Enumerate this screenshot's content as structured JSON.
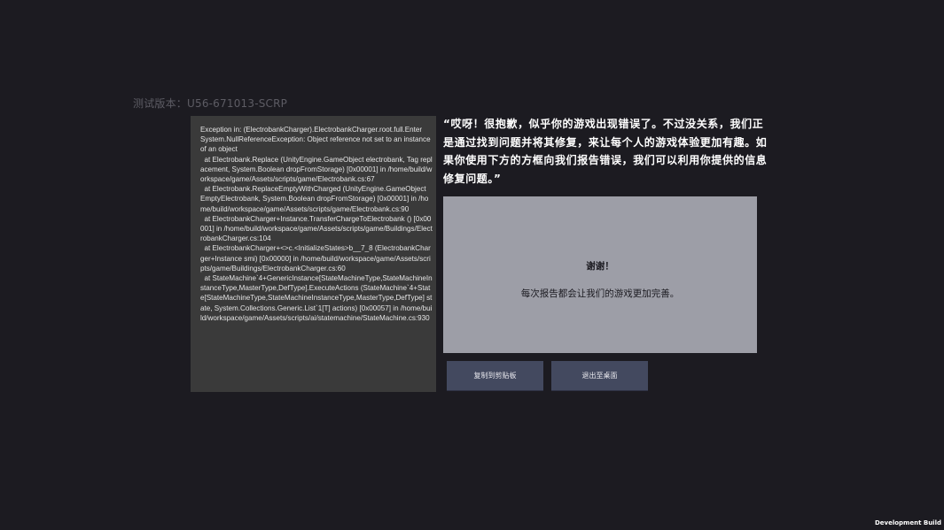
{
  "version_label": "测试版本：U56-671013-SCRP",
  "log": {
    "text": "Exception in: (ElectrobankCharger).ElectrobankCharger.root.full.Enter\nSystem.NullReferenceException: Object reference not set to an instance of an object\n  at Electrobank.Replace (UnityEngine.GameObject electrobank, Tag replacement, System.Boolean dropFromStorage) [0x00001] in /home/build/workspace/game/Assets/scripts/game/Electrobank.cs:67\n  at Electrobank.ReplaceEmptyWithCharged (UnityEngine.GameObject EmptyElectrobank, System.Boolean dropFromStorage) [0x00001] in /home/build/workspace/game/Assets/scripts/game/Electrobank.cs:90\n  at ElectrobankCharger+Instance.TransferChargeToElectrobank () [0x00001] in /home/build/workspace/game/Assets/scripts/game/Buildings/ElectrobankCharger.cs:104\n  at ElectrobankCharger+<>c.<InitializeStates>b__7_8 (ElectrobankCharger+Instance smi) [0x00000] in /home/build/workspace/game/Assets/scripts/game/Buildings/ElectrobankCharger.cs:60\n  at StateMachine`4+GenericInstance[StateMachineType,StateMachineInstanceType,MasterType,DefType].ExecuteActions (StateMachine`4+State[StateMachineType,StateMachineInstanceType,MasterType,DefType] state, System.Collections.Generic.List`1[T] actions) [0x00057] in /home/build/workspace/game/Assets/scripts/ai/statemachine/StateMachine.cs:930"
  },
  "apology_text": "“哎呀！很抱歉，似乎你的游戏出现错误了。不过没关系，我们正是通过找到问题并将其修复，来让每个人的游戏体验更加有趣。如果你使用下方的方框向我们报告错误，我们可以利用你提供的信息修复问题。”",
  "thanks_box": {
    "title": "谢谢！",
    "subtitle": "每次报告都会让我们的游戏更加完善。"
  },
  "buttons": {
    "copy_label": "复制到剪贴板",
    "exit_label": "退出至桌面"
  },
  "dev_build_label": "Development Build",
  "colors": {
    "background": "#1c1b21",
    "log_panel": "#3a3a3a",
    "thanks_box": "#9d9ea7",
    "button": "#43495f"
  }
}
